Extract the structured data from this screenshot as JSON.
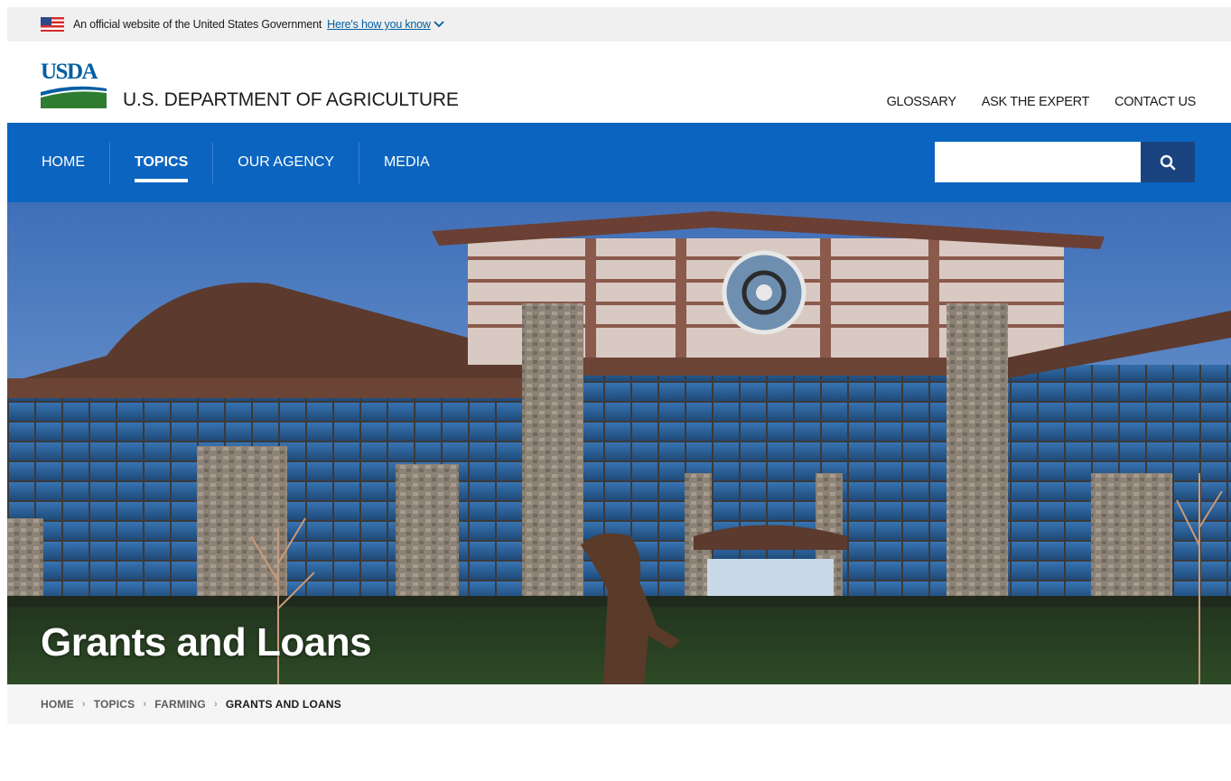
{
  "gov_banner": {
    "text": "An official website of the United States Government",
    "link": "Here's how you know"
  },
  "header": {
    "logo_text": "USDA",
    "dept_name": "U.S. DEPARTMENT OF AGRICULTURE",
    "utility_links": [
      "GLOSSARY",
      "ASK THE EXPERT",
      "CONTACT US"
    ]
  },
  "nav": {
    "items": [
      "HOME",
      "TOPICS",
      "OUR AGENCY",
      "MEDIA"
    ],
    "active": "TOPICS"
  },
  "search": {
    "placeholder": "",
    "icon": "search-icon"
  },
  "hero": {
    "title": "Grants and Loans"
  },
  "breadcrumb": [
    "HOME",
    "TOPICS",
    "FARMING",
    "GRANTS AND LOANS"
  ],
  "colors": {
    "nav_blue": "#0b64c0",
    "search_button": "#1a4480",
    "link_blue": "#005ea2",
    "usda_green": "#2e7d32"
  }
}
